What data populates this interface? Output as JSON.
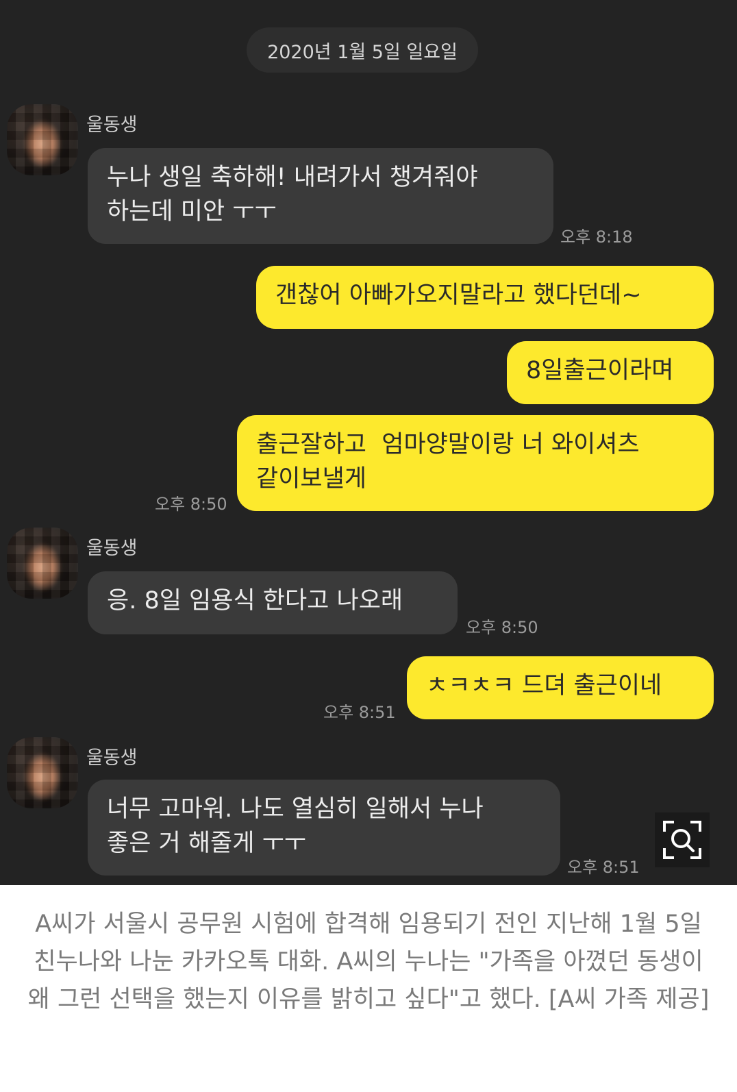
{
  "date_divider": "2020년 1월 5일 일요일",
  "sender_name": "울동생",
  "messages": [
    {
      "text": "누나 생일 축하해! 내려가서 챙겨줘야\n하는데 미안 ㅜㅜ",
      "time": "오후 8:18"
    },
    {
      "text": "갠찮어 아빠가오지말라고 했다던데~"
    },
    {
      "text": "8일출근이라며"
    },
    {
      "text": "출근잘하고  엄마양말이랑 너 와이셔츠\n같이보낼게",
      "time": "오후 8:50"
    },
    {
      "text": "응. 8일 임용식 한다고 나오래",
      "time": "오후 8:50"
    },
    {
      "text": "ㅊㅋㅊㅋ 드뎌 출근이네",
      "time": "오후 8:51"
    },
    {
      "text": "너무 고마워. 나도 열심히 일해서 누나\n좋은 거 해줄게 ㅜㅜ",
      "time": "오후 8:51"
    }
  ],
  "zoom_icon": "zoom-search-icon",
  "caption": "A씨가 서울시 공무원 시험에 합격해 임용되기 전인 지난해 1월 5일 친누나와 나눈 카카오톡 대화. A씨의 누나는 \"가족을 아꼈던 동생이 왜 그런 선택을 했는지 이유를 밝히고 싶다\"고 했다. [A씨 가족 제공]",
  "colors": {
    "background": "#232323",
    "incoming_bubble": "#3a3a3a",
    "outgoing_bubble": "#fde92d"
  }
}
